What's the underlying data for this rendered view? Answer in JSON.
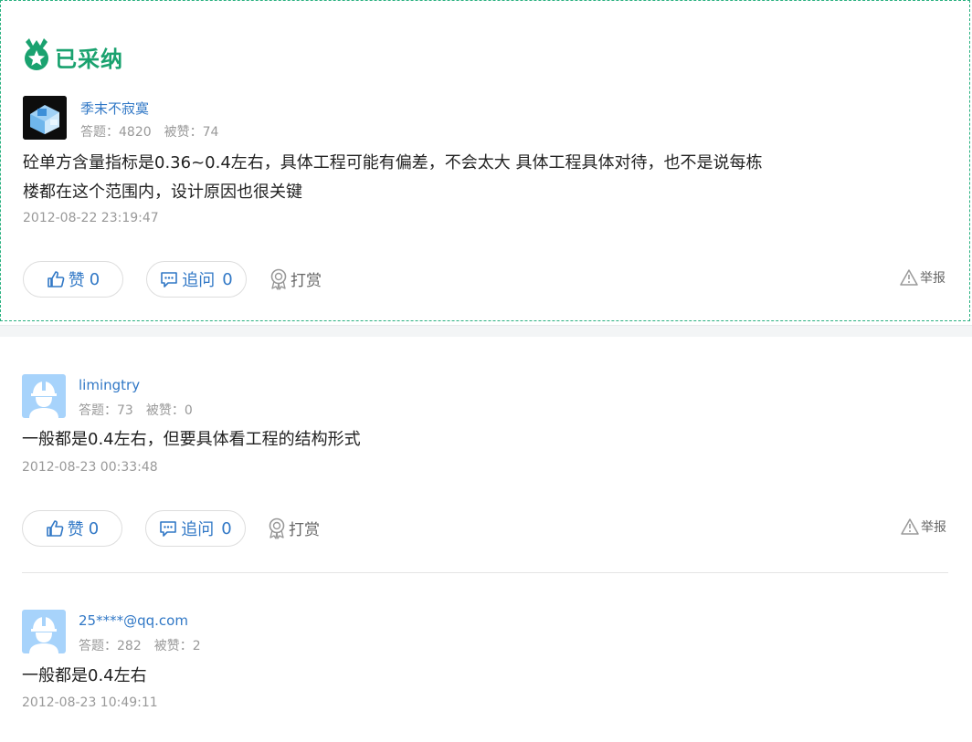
{
  "accepted_label": "已采纳",
  "answers": [
    {
      "user": "季末不寂寞",
      "answers_count": "答题：4820",
      "likes_count": "被赞：74",
      "content_line1": "砼单方含量指标是0.36~0.4左右，具体工程可能有偏差，不会太大 具体工程具体对待，也不是说每栋",
      "content_line2": "楼都在这个范围内，设计原因也很关键",
      "time": "2012-08-22 23:19:47",
      "like_label": "赞",
      "like_count": "0",
      "ask_label": "追问",
      "ask_count": "0",
      "tip_label": "打赏",
      "report_label": "举报"
    },
    {
      "user": "limingtry",
      "answers_count": "答题：73",
      "likes_count": "被赞：0",
      "content_line1": "一般都是0.4左右，但要具体看工程的结构形式",
      "time": "2012-08-23 00:33:48",
      "like_label": "赞",
      "like_count": "0",
      "ask_label": "追问",
      "ask_count": "0",
      "tip_label": "打赏",
      "report_label": "举报"
    },
    {
      "user": "25****@qq.com",
      "answers_count": "答题：282",
      "likes_count": "被赞：2",
      "content_line1": "一般都是0.4左右",
      "time": "2012-08-23 10:49:11"
    }
  ],
  "colors": {
    "accent_green": "#1aa26f",
    "link_blue": "#3178c6",
    "muted_gray": "#999999"
  }
}
